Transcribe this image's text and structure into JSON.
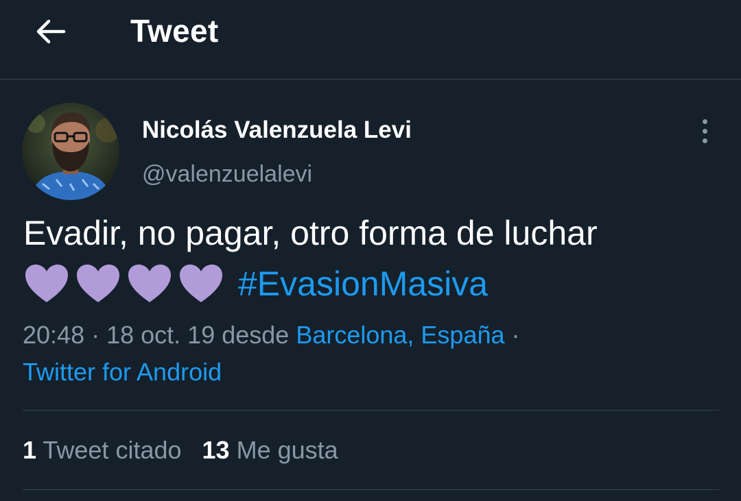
{
  "header": {
    "title": "Tweet",
    "back_icon": "arrow-left-icon"
  },
  "tweet": {
    "author": {
      "name": "Nicolás Valenzuela Levi",
      "handle": "@valenzuelalevi"
    },
    "text_line1": "Evadir, no pagar, otro forma de luchar",
    "emoji": [
      "purple-heart",
      "purple-heart",
      "purple-heart",
      "purple-heart"
    ],
    "hashtag": "#EvasionMasiva",
    "meta": {
      "time": "20:48",
      "sep1": " · ",
      "date": "18 oct. 19",
      "desde": " desde ",
      "location": "Barcelona, España",
      "sep2": " ·",
      "source": "Twitter for Android"
    },
    "stats": {
      "quotes_count": "1",
      "quotes_label": "Tweet citado",
      "likes_count": "13",
      "likes_label": "Me gusta"
    }
  },
  "colors": {
    "background": "#15202b",
    "link": "#1d9bf0",
    "secondary_text": "#8899a6",
    "divider": "#38444d",
    "heart": "#b19cd9"
  }
}
